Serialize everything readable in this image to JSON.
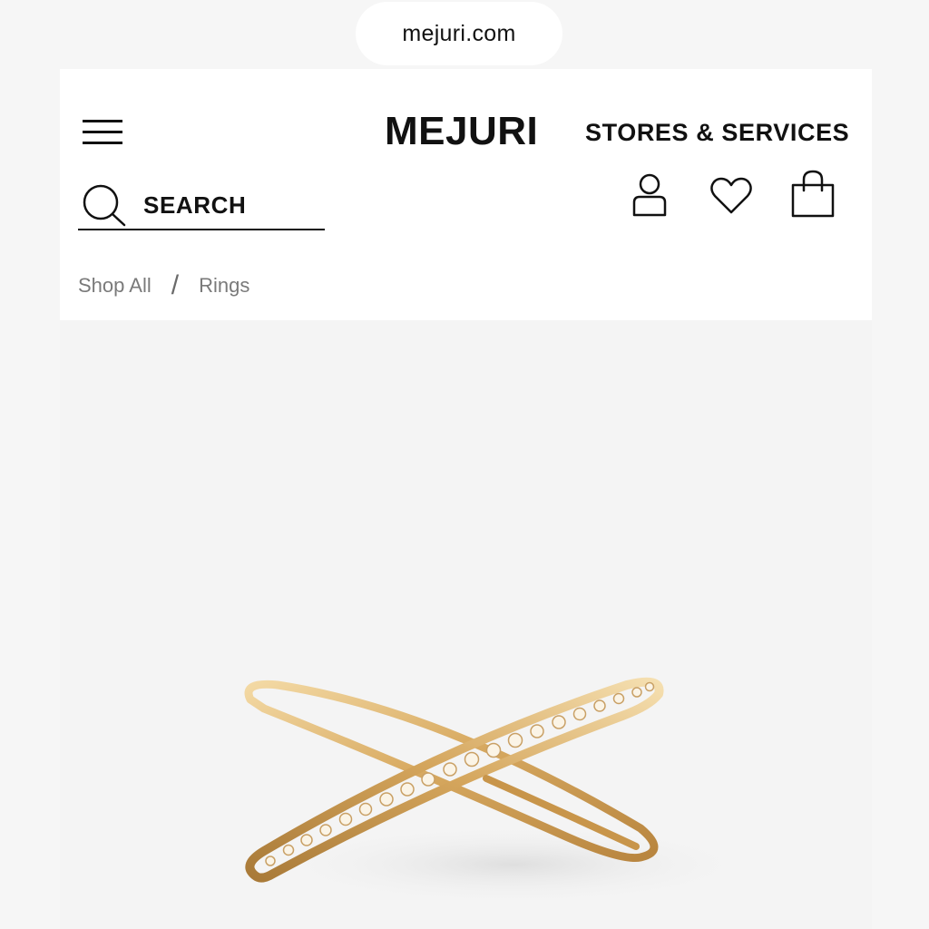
{
  "browser": {
    "url": "mejuri.com"
  },
  "header": {
    "logo": "MEJURI",
    "stores_link": "STORES & SERVICES",
    "search_label": "SEARCH",
    "icons": [
      "menu-icon",
      "search-icon",
      "account-icon",
      "heart-icon",
      "shopping-bag-icon"
    ]
  },
  "breadcrumb": {
    "items": [
      "Shop All",
      "Rings"
    ],
    "separator": "/"
  },
  "product": {
    "image": "gold-crossover-diamond-ring",
    "colors": {
      "gold": "#d9b06a",
      "background": "#f4f4f4"
    }
  }
}
